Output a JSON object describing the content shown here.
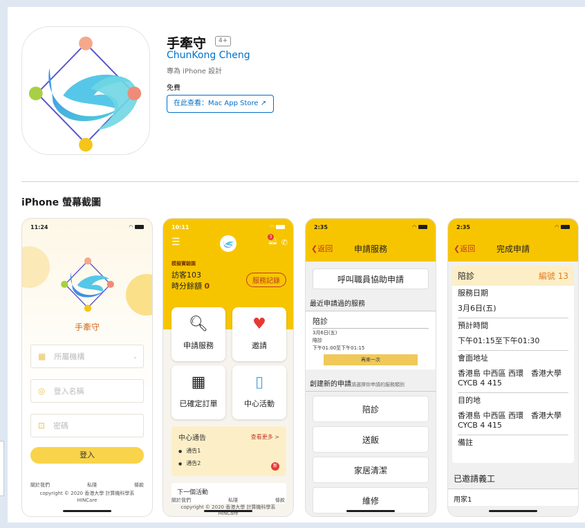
{
  "app": {
    "title": "手牽守",
    "age_rating": "4+",
    "developer": "ChunKong Cheng",
    "designed_for": "專為 iPhone 設計",
    "price": "免費",
    "mac_store_button": "在此查看：Mac App Store ↗"
  },
  "screenshots_section": {
    "title": "iPhone 螢幕截圖"
  },
  "colors": {
    "brand_yellow": "#f7c500",
    "link_blue": "#0070c9",
    "accent_red": "#c0392b"
  },
  "screen1": {
    "time": "11:24",
    "brand": "手牽守",
    "org_placeholder": "所屬機構",
    "username_placeholder": "登入名稱",
    "password_placeholder": "密碼",
    "login_button": "登入",
    "footer_links": [
      "關於我們",
      "私隱",
      "條款"
    ],
    "copyright_line1": "copyright © 2020 香港大學 計算機科學系",
    "copyright_line2": "HINCare"
  },
  "screen2": {
    "time": "10:11",
    "notification_count": "3",
    "demo_label": "模擬實驗園",
    "visitor": "訪客103",
    "balance_label": "時分餘額",
    "balance_value": "0",
    "records_button": "服務記錄",
    "tiles": [
      "申請服務",
      "邀請",
      "已確定訂單",
      "中心活動"
    ],
    "notice_title": "中心通告",
    "notice_more": "查看更多 >",
    "notices": [
      "通告1",
      "通告2"
    ],
    "new_badge": "新",
    "next_activity": "下一個活動",
    "footer_links": [
      "關於我們",
      "私隱",
      "條款"
    ],
    "copyright_line1": "copyright © 2020 香港大學 計算機科學系",
    "copyright_line2": "HINCare"
  },
  "screen3": {
    "time": "2:35",
    "back": "❮返回",
    "title": "申請服務",
    "call_staff": "呼叫職員協助申請",
    "recent_section": "最近申請過的服務",
    "recent_service": "陪診",
    "recent_date": "3月6日(五)",
    "recent_type": "陪診",
    "recent_time": "下午01:00至下午01:15",
    "again_button": "再來一次",
    "new_section": "創建新的申請",
    "new_section_hint": "請選擇你申請的服務類別",
    "categories": [
      "陪診",
      "送飯",
      "家居清潔",
      "維修"
    ]
  },
  "screen4": {
    "time": "2:35",
    "back": "❮返回",
    "title": "完成申請",
    "service": "陪診",
    "number": "編號 13",
    "date_label": "服務日期",
    "date_value": "3月6日(五)",
    "time_label": "預計時間",
    "time_value": "下午01:15至下午01:30",
    "meet_label": "會面地址",
    "meet_value": "香港島 中西區 西環　香港大學 CYCB 4 415",
    "dest_label": "目的地",
    "dest_value": "香港島 中西區 西環　香港大學 CYCB 4 415",
    "remarks_label": "備註",
    "invited_title": "已邀請義工",
    "worker": "用家1"
  }
}
